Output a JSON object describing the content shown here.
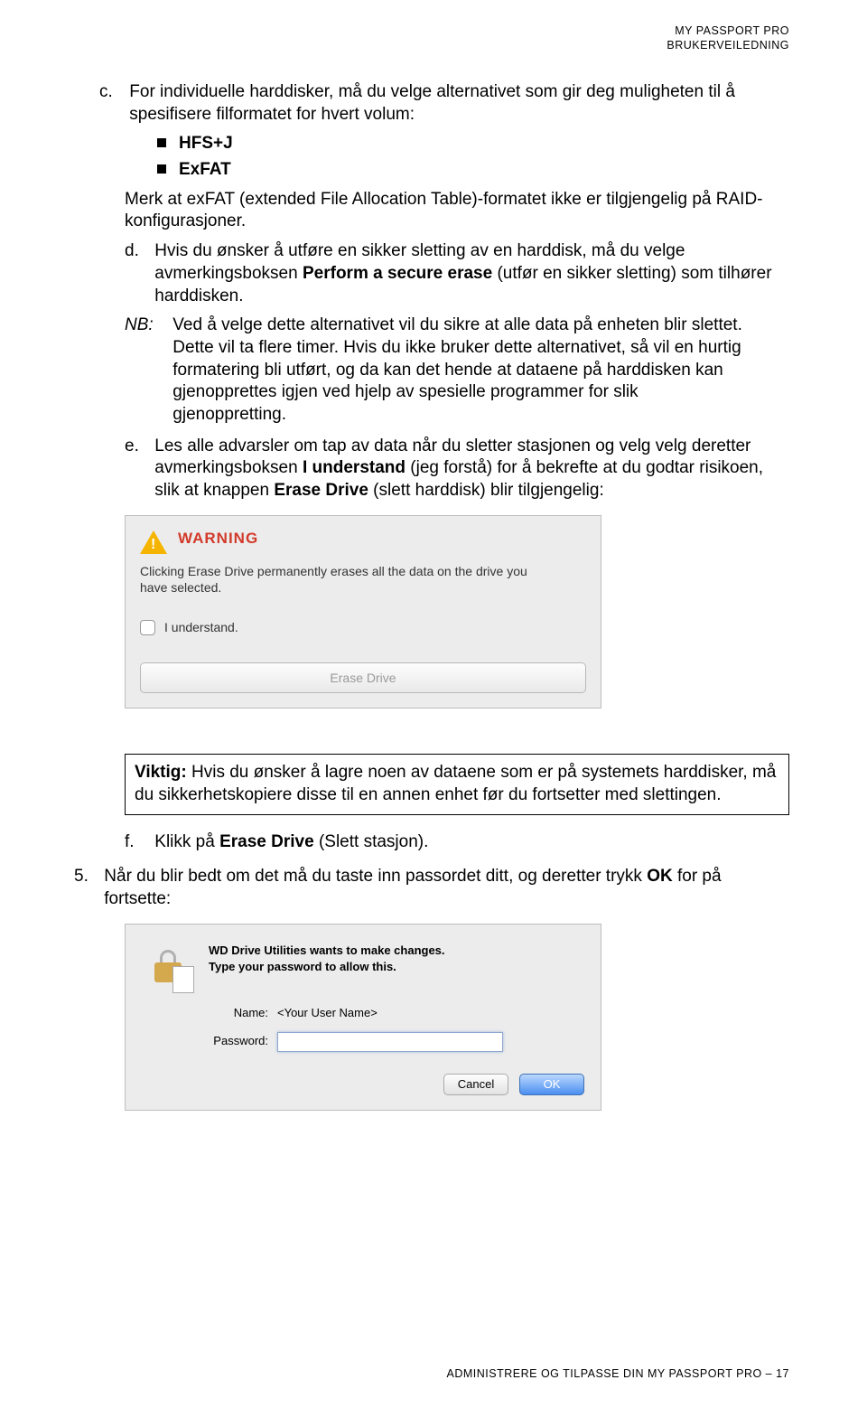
{
  "header": {
    "line1": "MY PASSPORT PRO",
    "line2": "BRUKERVEILEDNING"
  },
  "c": {
    "marker": "c.",
    "intro": "For individuelle harddisker, må du velge alternativet som gir deg muligheten til å spesifisere filformatet for hvert volum:",
    "bullets": [
      "HFS+J",
      "ExFAT"
    ],
    "note": "Merk at exFAT (extended File Allocation Table)-formatet ikke er tilgjengelig på RAID-konfigurasjoner."
  },
  "d": {
    "marker": "d.",
    "pre": "Hvis du ønsker å utføre en sikker sletting av en harddisk, må du velge avmerkingsboksen ",
    "bold": "Perform a secure erase",
    "post": " (utfør en sikker sletting) som tilhører harddisken."
  },
  "nb": {
    "label": "NB:",
    "text": "Ved å velge dette alternativet vil du sikre at alle data på enheten blir slettet. Dette vil ta flere timer. Hvis du ikke bruker dette alternativet, så vil en hurtig formatering bli utført, og da kan det hende at dataene på harddisken kan gjenopprettes igjen ved hjelp av spesielle programmer for slik gjenoppretting."
  },
  "e": {
    "marker": "e.",
    "pre": "Les alle advarsler om tap av data når du sletter stasjonen og velg velg deretter avmerkingsboksen ",
    "b1": "I understand",
    "mid": " (jeg forstå) for å bekrefte at du godtar risikoen, slik at knappen ",
    "b2": "Erase Drive",
    "post": " (slett harddisk) blir tilgjengelig:"
  },
  "warn": {
    "title": "WARNING",
    "desc": "Clicking Erase Drive permanently erases all the data on the drive you have selected.",
    "check": "I understand.",
    "button": "Erase Drive"
  },
  "viktig": {
    "bold": "Viktig:",
    "text": " Hvis du ønsker å lagre noen av dataene som er på systemets harddisker, må du sikkerhetskopiere disse til en annen enhet før du fortsetter med slettingen."
  },
  "f": {
    "marker": "f.",
    "pre": "Klikk på ",
    "bold": "Erase Drive",
    "post": " (Slett stasjon)."
  },
  "step5": {
    "marker": "5.",
    "pre": "Når du blir bedt om det må du taste inn passordet ditt, og deretter trykk ",
    "bold": "OK",
    "post": " for på fortsette:"
  },
  "auth": {
    "line1": "WD Drive Utilities wants to make changes.",
    "line2": "Type your password to allow this.",
    "name_label": "Name:",
    "name_value": "<Your User Name>",
    "pw_label": "Password:",
    "cancel": "Cancel",
    "ok": "OK"
  },
  "footer": "ADMINISTRERE OG TILPASSE DIN MY PASSPORT PRO – 17"
}
